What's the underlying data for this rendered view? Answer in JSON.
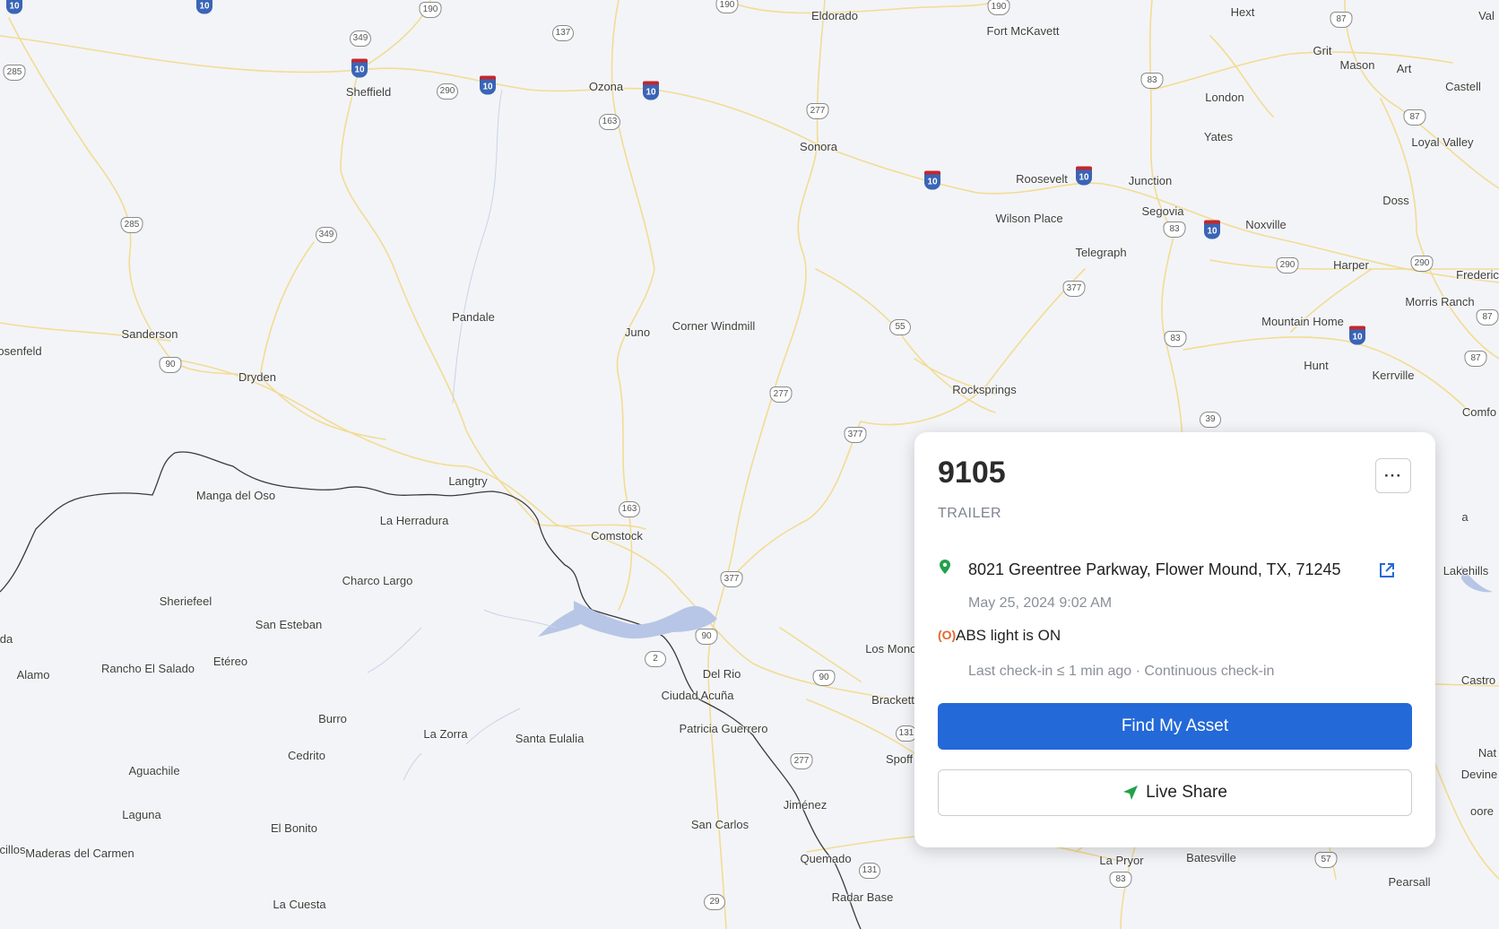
{
  "map": {
    "places": [
      {
        "name": "Eldorado"
      },
      {
        "name": "Fort McKavett"
      },
      {
        "name": "Hext"
      },
      {
        "name": "Val"
      },
      {
        "name": "Grit"
      },
      {
        "name": "Mason"
      },
      {
        "name": "Art"
      },
      {
        "name": "Castell"
      },
      {
        "name": "Sheffield"
      },
      {
        "name": "Ozona"
      },
      {
        "name": "London"
      },
      {
        "name": "Yates"
      },
      {
        "name": "Loyal Valley"
      },
      {
        "name": "Sonora"
      },
      {
        "name": "Roosevelt"
      },
      {
        "name": "Junction"
      },
      {
        "name": "Doss"
      },
      {
        "name": "Segovia"
      },
      {
        "name": "Wilson Place"
      },
      {
        "name": "Noxville"
      },
      {
        "name": "Telegraph"
      },
      {
        "name": "Harper"
      },
      {
        "name": "Frederic"
      },
      {
        "name": "Morris Ranch"
      },
      {
        "name": "Pandale"
      },
      {
        "name": "Juno"
      },
      {
        "name": "Corner Windmill"
      },
      {
        "name": "Mountain Home"
      },
      {
        "name": "Sanderson"
      },
      {
        "name": "osenfeld"
      },
      {
        "name": "Dryden"
      },
      {
        "name": "Hunt"
      },
      {
        "name": "Kerrville"
      },
      {
        "name": "Rocksprings"
      },
      {
        "name": "Comfo"
      },
      {
        "name": "Langtry"
      },
      {
        "name": "Manga del Oso"
      },
      {
        "name": "La Herradura"
      },
      {
        "name": "Comstock"
      },
      {
        "name": "a"
      },
      {
        "name": "Charco Largo"
      },
      {
        "name": "Lakehills"
      },
      {
        "name": "Sheriefeel"
      },
      {
        "name": "San Esteban"
      },
      {
        "name": "da"
      },
      {
        "name": "Alamo"
      },
      {
        "name": "Rancho El Salado"
      },
      {
        "name": "Etéreo"
      },
      {
        "name": "Los Monos"
      },
      {
        "name": "Del Rio"
      },
      {
        "name": "Castro"
      },
      {
        "name": "Ciudad Acuña"
      },
      {
        "name": "Brackett"
      },
      {
        "name": "Burro"
      },
      {
        "name": "Patricia Guerrero"
      },
      {
        "name": "La Zorra"
      },
      {
        "name": "Santa Eulalia"
      },
      {
        "name": "Nat"
      },
      {
        "name": "Cedrito"
      },
      {
        "name": "Spoff"
      },
      {
        "name": "Aguachile"
      },
      {
        "name": "Devine"
      },
      {
        "name": "Jiménez"
      },
      {
        "name": "Laguna"
      },
      {
        "name": "oore"
      },
      {
        "name": "San Carlos"
      },
      {
        "name": "El Bonito"
      },
      {
        "name": "cillos"
      },
      {
        "name": "Maderas del Carmen"
      },
      {
        "name": "Quemado"
      },
      {
        "name": "La Pryor"
      },
      {
        "name": "Batesville"
      },
      {
        "name": "Pearsall"
      },
      {
        "name": "Radar Base"
      },
      {
        "name": "La Cuesta"
      }
    ],
    "shields": [
      {
        "type": "i",
        "num": "10"
      },
      {
        "type": "i",
        "num": "10"
      },
      {
        "type": "us",
        "num": "190"
      },
      {
        "type": "us",
        "num": "190"
      },
      {
        "type": "us",
        "num": "190"
      },
      {
        "type": "us",
        "num": "87"
      },
      {
        "type": "st",
        "num": "137"
      },
      {
        "type": "st",
        "num": "349"
      },
      {
        "type": "i",
        "num": "10"
      },
      {
        "type": "us",
        "num": "285"
      },
      {
        "type": "st",
        "num": "290"
      },
      {
        "type": "i",
        "num": "10"
      },
      {
        "type": "i",
        "num": "10"
      },
      {
        "type": "us",
        "num": "83"
      },
      {
        "type": "st",
        "num": "163"
      },
      {
        "type": "us",
        "num": "277"
      },
      {
        "type": "us",
        "num": "87"
      },
      {
        "type": "i",
        "num": "10"
      },
      {
        "type": "i",
        "num": "10"
      },
      {
        "type": "us",
        "num": "285"
      },
      {
        "type": "st",
        "num": "349"
      },
      {
        "type": "us",
        "num": "83"
      },
      {
        "type": "i",
        "num": "10"
      },
      {
        "type": "us",
        "num": "290"
      },
      {
        "type": "us",
        "num": "290"
      },
      {
        "type": "us",
        "num": "377"
      },
      {
        "type": "us",
        "num": "87"
      },
      {
        "type": "st",
        "num": "55"
      },
      {
        "type": "us",
        "num": "83"
      },
      {
        "type": "i",
        "num": "10"
      },
      {
        "type": "us",
        "num": "90"
      },
      {
        "type": "us",
        "num": "87"
      },
      {
        "type": "us",
        "num": "277"
      },
      {
        "type": "us",
        "num": "377"
      },
      {
        "type": "st",
        "num": "39"
      },
      {
        "type": "st",
        "num": "163"
      },
      {
        "type": "us",
        "num": "377"
      },
      {
        "type": "us",
        "num": "90"
      },
      {
        "type": "st",
        "num": "2"
      },
      {
        "type": "us",
        "num": "90"
      },
      {
        "type": "st",
        "num": "131"
      },
      {
        "type": "us",
        "num": "277"
      },
      {
        "type": "us",
        "num": "57"
      },
      {
        "type": "us",
        "num": "83"
      },
      {
        "type": "st",
        "num": "131"
      },
      {
        "type": "st",
        "num": "29"
      }
    ]
  },
  "asset": {
    "id": "9105",
    "type": "TRAILER",
    "more_label": "···",
    "address": "8021 Greentree Parkway, Flower Mound, TX, 71245",
    "timestamp": "May 25, 2024 9:02 AM",
    "abs_icon": "(O)",
    "abs_status": "ABS light is ON",
    "checkin": "Last check-in ≤ 1 min ago · Continuous check-in",
    "find_label": "Find My Asset",
    "share_label": "Live Share"
  },
  "colors": {
    "accent": "#2369d8",
    "pin": "#22a04b",
    "alert": "#e0692d",
    "road": "#f2dc94",
    "water": "#b7c6e6",
    "border": "#3a3a3a"
  }
}
